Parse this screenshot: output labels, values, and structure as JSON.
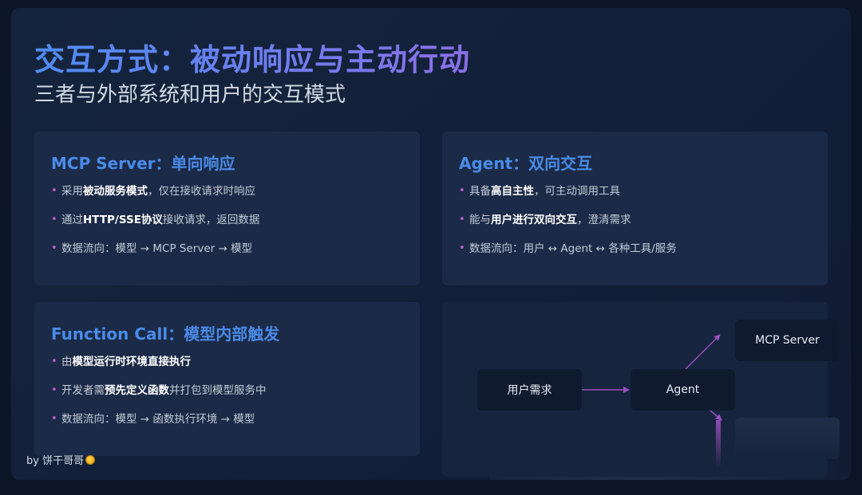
{
  "title": "交互方式：被动响应与主动行动",
  "subtitle": "三者与外部系统和用户的交互模式",
  "cards": {
    "mcp": {
      "heading": "MCP Server：单向响应",
      "items": [
        {
          "pre": "采用",
          "bold": "被动服务模式",
          "post": "，仅在接收请求时响应"
        },
        {
          "pre": "通过",
          "bold": "HTTP/SSE协议",
          "post": "接收请求，返回数据"
        },
        {
          "pre": "数据流向：模型 → MCP Server → 模型",
          "bold": "",
          "post": ""
        }
      ]
    },
    "agent": {
      "heading": "Agent：双向交互",
      "items": [
        {
          "pre": "具备",
          "bold": "高自主性",
          "post": "，可主动调用工具"
        },
        {
          "pre": "能与",
          "bold": "用户进行双向交互",
          "post": "，澄清需求"
        },
        {
          "pre": "数据流向：用户 ↔ Agent ↔ 各种工具/服务",
          "bold": "",
          "post": ""
        }
      ]
    },
    "function_call": {
      "heading": "Function Call：模型内部触发",
      "items": [
        {
          "pre": "由",
          "bold": "模型运行时环境直接执行",
          "post": ""
        },
        {
          "pre": "开发者需",
          "bold": "预先定义函数",
          "post": "并打包到模型服务中"
        },
        {
          "pre": "数据流向：模型 → 函数执行环境 → 模型",
          "bold": "",
          "post": ""
        }
      ]
    }
  },
  "diagram": {
    "nodes": {
      "user_need": "用户需求",
      "agent": "Agent",
      "mcp_server": "MCP Server",
      "hidden": ""
    }
  },
  "footer": {
    "text": "by 饼干哥哥"
  },
  "colors": {
    "heading": "#4a8be8",
    "bullet": "#c05fd0",
    "arrow": "#9b4fc0"
  }
}
